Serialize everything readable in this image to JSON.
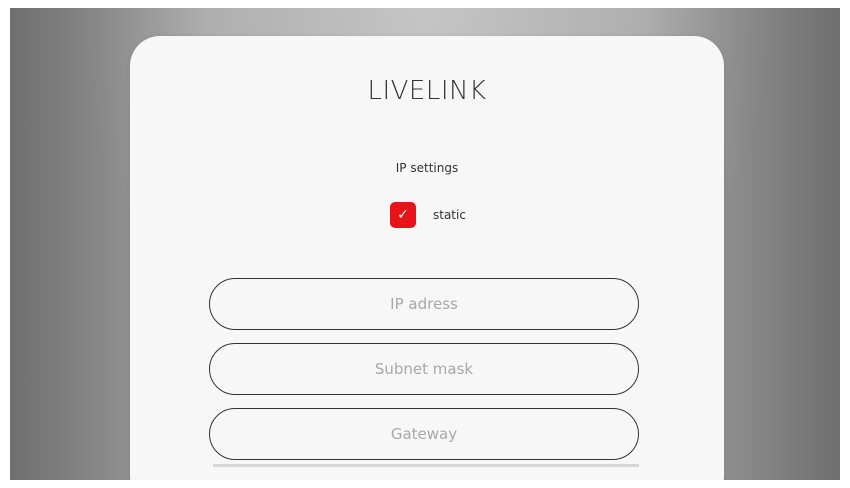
{
  "app": {
    "title": "LIVELINK"
  },
  "ip_settings": {
    "title": "IP settings",
    "static": {
      "label": "static",
      "checked": true,
      "check_glyph": "✓",
      "checkbox_color": "#e8121b"
    },
    "fields": {
      "ip_address": {
        "placeholder": "IP adress",
        "value": ""
      },
      "subnet_mask": {
        "placeholder": "Subnet mask",
        "value": ""
      },
      "gateway": {
        "placeholder": "Gateway",
        "value": ""
      }
    }
  },
  "colors": {
    "card_background": "#f7f7f7",
    "text": "#333333",
    "placeholder_text": "#a8a8a8",
    "accent": "#e8121b"
  }
}
